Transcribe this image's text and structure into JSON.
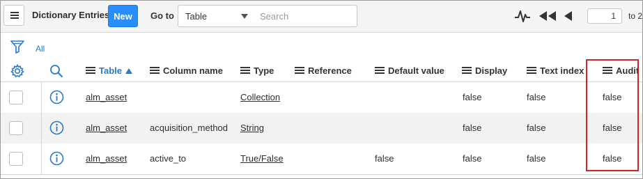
{
  "header": {
    "title": "Dictionary Entries",
    "new_label": "New",
    "goto_label": "Go to",
    "goto_select_value": "Table",
    "search_placeholder": "Search",
    "page_number": "1",
    "page_of": "to 2"
  },
  "filter": {
    "all_label": "All"
  },
  "columns": [
    {
      "label": "Table",
      "sorted": "ascending"
    },
    {
      "label": "Column name"
    },
    {
      "label": "Type"
    },
    {
      "label": "Reference"
    },
    {
      "label": "Default value"
    },
    {
      "label": "Display"
    },
    {
      "label": "Text index"
    },
    {
      "label": "Audit"
    }
  ],
  "rows": [
    {
      "table": "alm_asset",
      "column_name": "",
      "type": "Collection",
      "reference": "",
      "default_value": "",
      "display": "false",
      "text_index": "false",
      "audit": "false"
    },
    {
      "table": "alm_asset",
      "column_name": "acquisition_method",
      "type": "String",
      "reference": "",
      "default_value": "",
      "display": "false",
      "text_index": "false",
      "audit": "false"
    },
    {
      "table": "alm_asset",
      "column_name": "active_to",
      "type": "True/False",
      "reference": "",
      "default_value": "false",
      "display": "false",
      "text_index": "false",
      "audit": "false"
    }
  ],
  "colors": {
    "accent": "#278efc",
    "link": "#2a79c8",
    "highlight": "#d0242b"
  },
  "icons": [
    "hamburger-menu-icon",
    "activity-stream-icon",
    "first-page-icon",
    "previous-page-icon",
    "filter-funnel-icon",
    "gear-icon",
    "search-icon",
    "info-icon"
  ]
}
